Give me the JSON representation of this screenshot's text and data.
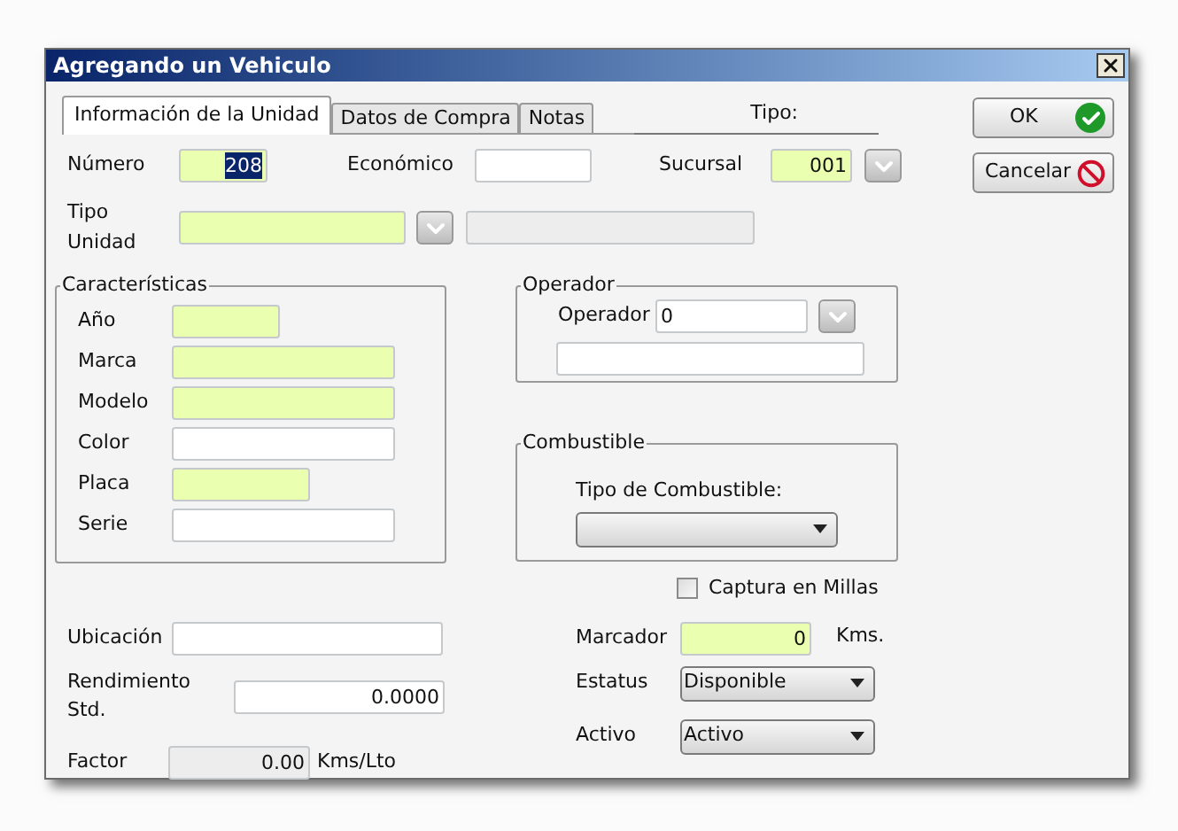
{
  "window": {
    "title": "Agregando un Vehiculo"
  },
  "tabs": [
    {
      "label": "Información de la Unidad",
      "selected": true
    },
    {
      "label": "Datos de Compra",
      "selected": false
    },
    {
      "label": "Notas",
      "selected": false
    }
  ],
  "tipo": {
    "label": "Tipo:"
  },
  "buttons": [
    {
      "label": "OK",
      "kind": "ok"
    },
    {
      "label": "Cancelar",
      "kind": "cancel"
    }
  ],
  "numero": {
    "label": "Número",
    "value": "208",
    "required": true,
    "text_selected": true
  },
  "economico": {
    "label": "Económico",
    "required": false
  },
  "sucursal": {
    "label": "Sucursal",
    "value": "001",
    "required": true
  },
  "tipo_unidad": {
    "label": "Tipo Unidad",
    "required": true
  },
  "caracteristicas": {
    "title": "Características",
    "fields": [
      {
        "label": "Año",
        "required": true
      },
      {
        "label": "Marca",
        "required": true
      },
      {
        "label": "Modelo",
        "required": true
      },
      {
        "label": "Color",
        "required": false
      },
      {
        "label": "Placa",
        "required": true
      },
      {
        "label": "Serie",
        "required": false
      }
    ]
  },
  "operador": {
    "title": "Operador",
    "label": "Operador",
    "value": "0"
  },
  "combustible": {
    "title": "Combustible",
    "label": "Tipo de Combustible:"
  },
  "captura_millas": {
    "label": "Captura en Millas",
    "checked": false
  },
  "ubicacion": {
    "label": "Ubicación"
  },
  "rendimiento": {
    "label": "Rendimiento Std.",
    "value": "0.0000"
  },
  "factor": {
    "label": "Factor",
    "value": "0.00",
    "unit": "Kms/Lto",
    "disabled": true
  },
  "marcador": {
    "label": "Marcador",
    "value": "0",
    "unit": "Kms.",
    "required": true
  },
  "estatus": {
    "label": "Estatus",
    "value": "Disponible"
  },
  "activo": {
    "label": "Activo",
    "value": "Activo"
  }
}
